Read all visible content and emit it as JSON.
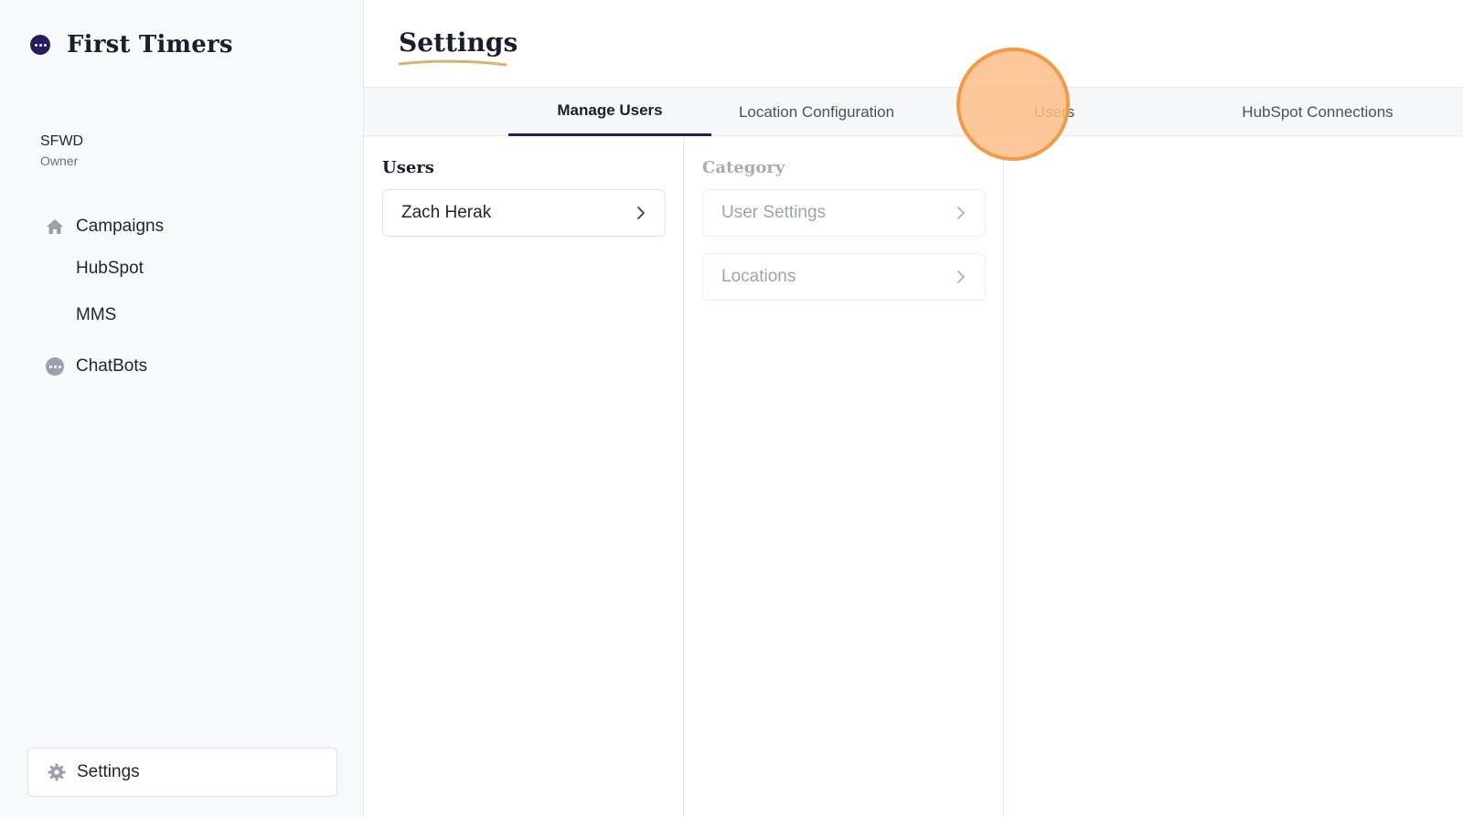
{
  "brand": {
    "name": "First Timers",
    "logo_icon": "chat-bubble-icon"
  },
  "account": {
    "name": "SFWD",
    "role": "Owner"
  },
  "nav": {
    "campaigns": "Campaigns",
    "hubspot": "HubSpot",
    "mms": "MMS",
    "chatbots": "ChatBots"
  },
  "sidebar_settings": "Settings",
  "page": {
    "title": "Settings"
  },
  "tabs": [
    {
      "label": "Manage Users",
      "active": true
    },
    {
      "label": "Location Configuration",
      "active": false
    },
    {
      "label": "Users",
      "active": false
    },
    {
      "label": "HubSpot Connections",
      "active": false
    }
  ],
  "users_panel": {
    "heading": "Users",
    "items": [
      {
        "label": "Zach Herak"
      }
    ]
  },
  "category_panel": {
    "heading": "Category",
    "items": [
      {
        "label": "User Settings"
      },
      {
        "label": "Locations"
      }
    ]
  },
  "colors": {
    "brand_dark": "#2a1a5e",
    "highlight_fill": "#fcbe8a",
    "highlight_border": "#f39a45",
    "title_underline": "#d9b26f"
  }
}
